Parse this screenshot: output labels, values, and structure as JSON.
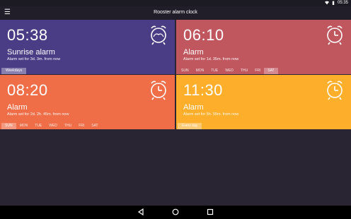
{
  "status": {
    "time": "05:35"
  },
  "toolbar": {
    "title": "Rooster alarm clock"
  },
  "alarms": [
    {
      "time": "05:38",
      "name": "Sunrise alarm",
      "subtitle": "Alarm set for 3d. 3m. from now",
      "repeat_chip": "Weekdays",
      "color": "#4a3d86"
    },
    {
      "time": "06:10",
      "name": "Alarm",
      "subtitle": "Alarm set for 1d. 35m. from now",
      "days": [
        "SUN",
        "MON",
        "TUE",
        "WED",
        "THU",
        "FRI",
        "SAT"
      ],
      "active_days": [
        "SAT"
      ],
      "color": "#c0575f"
    },
    {
      "time": "08:20",
      "name": "Alarm",
      "subtitle": "Alarm set for 2d. 2h. 45m. from now",
      "days": [
        "SUN",
        "MON",
        "TUE",
        "WED",
        "THU",
        "FRI",
        "SAT"
      ],
      "active_days": [
        "SUN"
      ],
      "color": "#ef6e48"
    },
    {
      "time": "11:30",
      "name": "Alarm",
      "subtitle": "Alarm set for 5h. 55m. from now",
      "repeat_chip": "Every day",
      "color": "#fdae2b"
    }
  ]
}
